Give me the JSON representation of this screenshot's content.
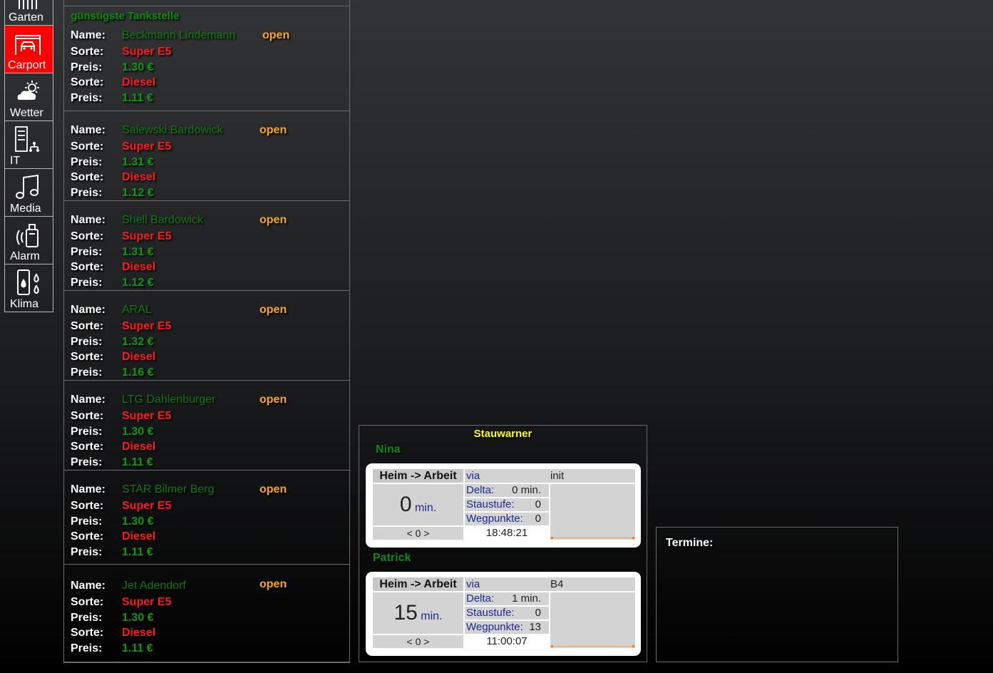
{
  "nav": [
    {
      "label": "Garten",
      "icon": "garden-gate-icon",
      "active": false
    },
    {
      "label": "Carport",
      "icon": "carport-garage-icon",
      "active": true
    },
    {
      "label": "Wetter",
      "icon": "weather-cloud-sun-icon",
      "active": false
    },
    {
      "label": "IT",
      "icon": "server-network-icon",
      "active": false
    },
    {
      "label": "Media",
      "icon": "music-note-icon",
      "active": false
    },
    {
      "label": "Alarm",
      "icon": "alarm-sensor-icon",
      "active": false
    },
    {
      "label": "Klima",
      "icon": "thermometer-drops-icon",
      "active": false
    }
  ],
  "fuel": {
    "heading": "günstigste Tankstelle",
    "labels": {
      "name": "Name:",
      "sorte": "Sorte:",
      "preis": "Preis:"
    },
    "stations": [
      {
        "name": "Beckmann Lindemann",
        "status": "open",
        "fuel1": "Super E5",
        "price1": "1.30 €",
        "fuel2": "Diesel",
        "price2": "1.11 €"
      },
      {
        "name": "Salewski Bardowick",
        "status": "open",
        "fuel1": "Super E5",
        "price1": "1.31 €",
        "fuel2": "Diesel",
        "price2": "1.12 €"
      },
      {
        "name": "Shell Bardowick",
        "status": "open",
        "fuel1": "Super E5",
        "price1": "1.31 €",
        "fuel2": "Diesel",
        "price2": "1.12 €"
      },
      {
        "name": "ARAL",
        "status": "open",
        "fuel1": "Super E5",
        "price1": "1.32 €",
        "fuel2": "Diesel",
        "price2": "1.16 €"
      },
      {
        "name": "LTG Dahlenburger",
        "status": "open",
        "fuel1": "Super E5",
        "price1": "1.30 €",
        "fuel2": "Diesel",
        "price2": "1.11 €"
      },
      {
        "name": "STAR Bilmer Berg",
        "status": "open",
        "fuel1": "Super E5",
        "price1": "1.30 €",
        "fuel2": "Diesel",
        "price2": "1.11 €"
      },
      {
        "name": "Jet Adendorf",
        "status": "open",
        "fuel1": "Super E5",
        "price1": "1.30 €",
        "fuel2": "Diesel",
        "price2": "1.11 €"
      }
    ]
  },
  "stauwarner": {
    "title": "Stauwarner",
    "labels": {
      "via": "via",
      "delta": "Delta:",
      "staustufe": "Staustufe:",
      "wegpunkte": "Wegpunkte:",
      "unit": "min.",
      "nav": "< 0 >"
    },
    "people": [
      {
        "name": "Nina",
        "route": "Heim -> Arbeit",
        "via": "init",
        "minutes": "0",
        "delta": "0 min.",
        "staustufe": "0",
        "wegpunkte": "0",
        "time": "18:48:21"
      },
      {
        "name": "Patrick",
        "route": "Heim -> Arbeit",
        "via": "B4",
        "minutes": "15",
        "delta": "1 min.",
        "staustufe": "0",
        "wegpunkte": "13",
        "time": "11:00:07"
      }
    ]
  },
  "termine": {
    "label": "Termine:"
  },
  "colors": {
    "active_nav": "#ff0000",
    "status_open": "#ffaa00",
    "fuel_type": "#ff1a1a",
    "price": "#0a9a0a",
    "station_name": "#0f7a0f",
    "stauwarner_title": "#ffff00"
  }
}
